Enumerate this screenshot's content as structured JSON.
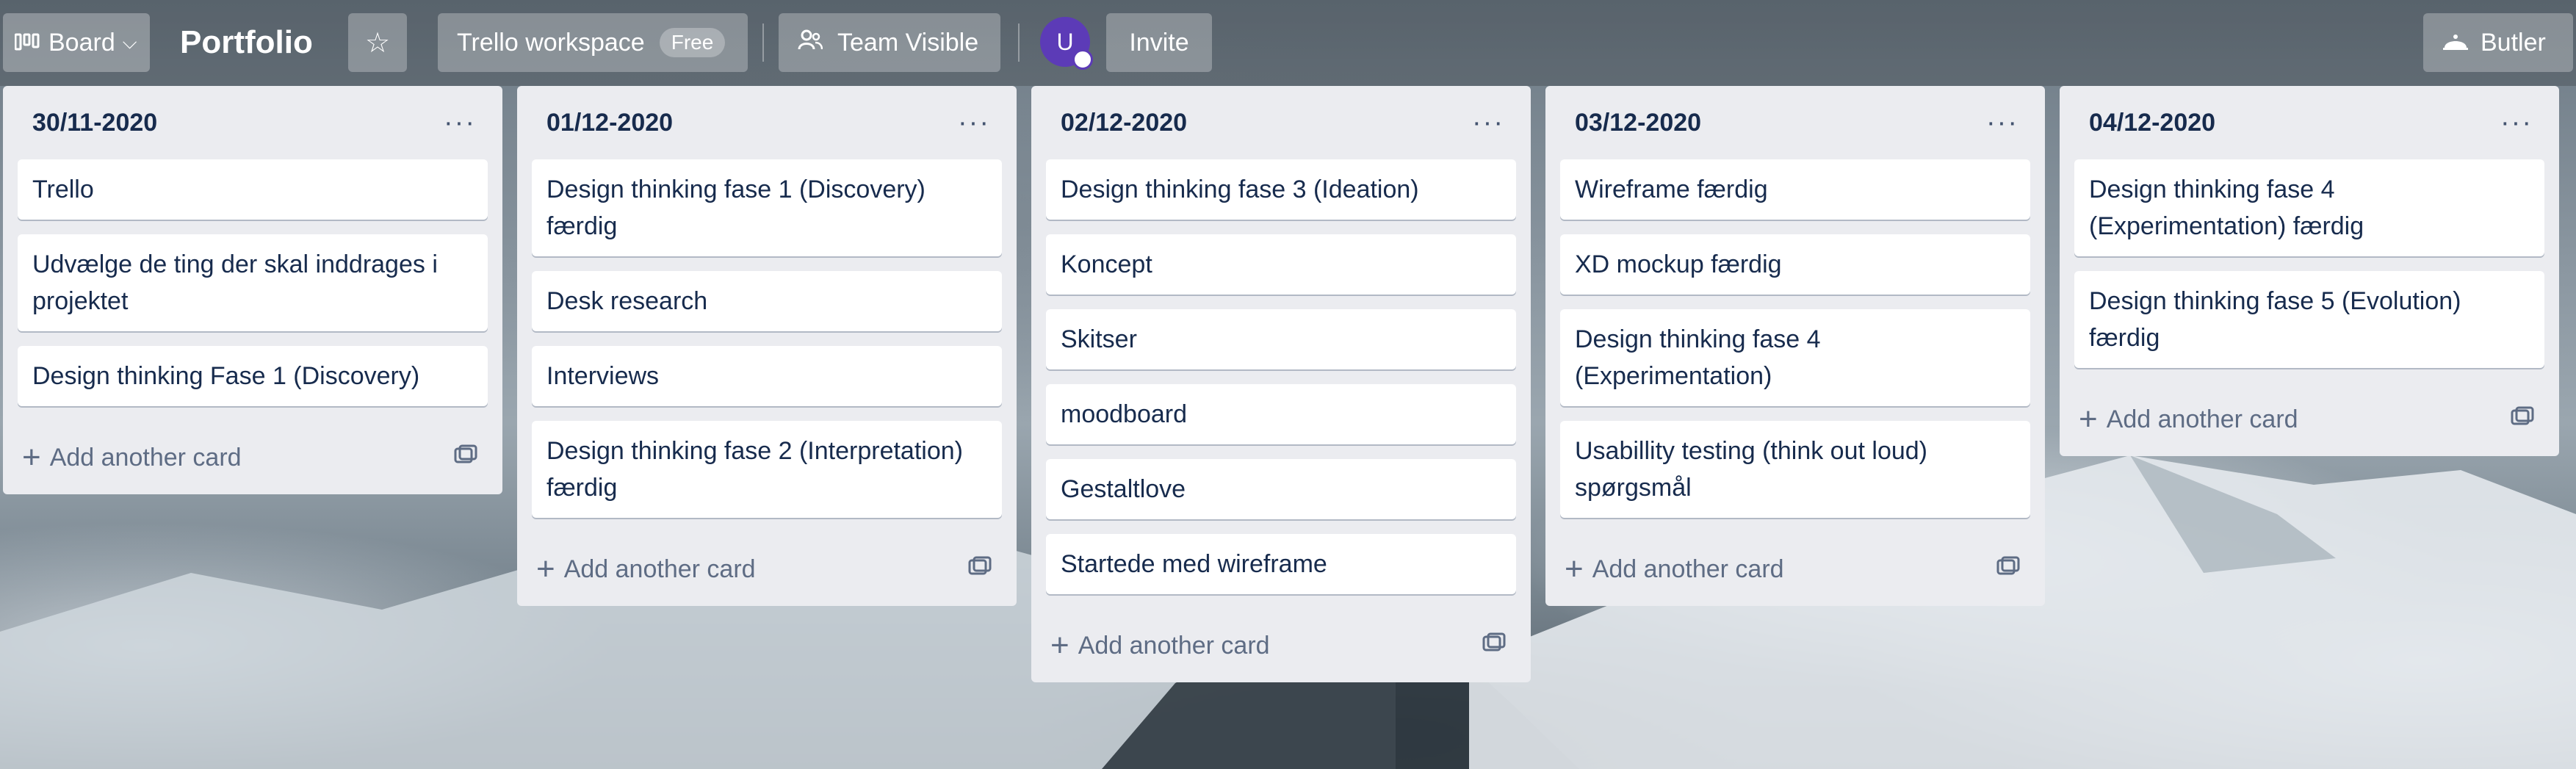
{
  "header": {
    "board_button": {
      "icon": "board-icon",
      "label": "Board",
      "chevron": "⌵"
    },
    "board_title": "Portfolio",
    "star_icon": "☆",
    "workspace": {
      "label": "Trello workspace",
      "badge": "Free"
    },
    "visibility": {
      "icon": "team-icon",
      "label": "Team Visible"
    },
    "avatar": {
      "initial": "U",
      "color": "#5c3bb7"
    },
    "invite_label": "Invite",
    "butler": {
      "icon": "butler-icon",
      "label": "Butler"
    }
  },
  "lists": [
    {
      "title": "30/11-2020",
      "menu": "···",
      "cards": [
        "Trello",
        "Udvælge de ting der skal inddrages i projektet",
        "Design thinking Fase 1 (Discovery)"
      ],
      "add_label": "Add another card"
    },
    {
      "title": "01/12-2020",
      "menu": "···",
      "cards": [
        "Design thinking fase 1 (Discovery) færdig",
        "Desk research",
        "Interviews",
        "Design thinking fase 2 (Interpretation) færdig"
      ],
      "add_label": "Add another card"
    },
    {
      "title": "02/12-2020",
      "menu": "···",
      "cards": [
        "Design thinking fase 3 (Ideation)",
        "Koncept",
        "Skitser",
        "moodboard",
        "Gestaltlove",
        "Startede med wireframe"
      ],
      "add_label": "Add another card"
    },
    {
      "title": "03/12-2020",
      "menu": "···",
      "cards": [
        "Wireframe færdig",
        "XD mockup færdig",
        "Design thinking fase 4 (Experimentation)",
        "Usabillity testing (think out loud) spørgsmål"
      ],
      "add_label": "Add another card"
    },
    {
      "title": "04/12-2020",
      "menu": "···",
      "cards": [
        "Design thinking fase 4 (Experimentation) færdig",
        "Design thinking fase 5 (Evolution) færdig"
      ],
      "add_label": "Add another card"
    }
  ],
  "colors": {
    "list_bg": "#ebecf0",
    "card_text": "#172b4d",
    "muted_text": "#5e6c84"
  }
}
